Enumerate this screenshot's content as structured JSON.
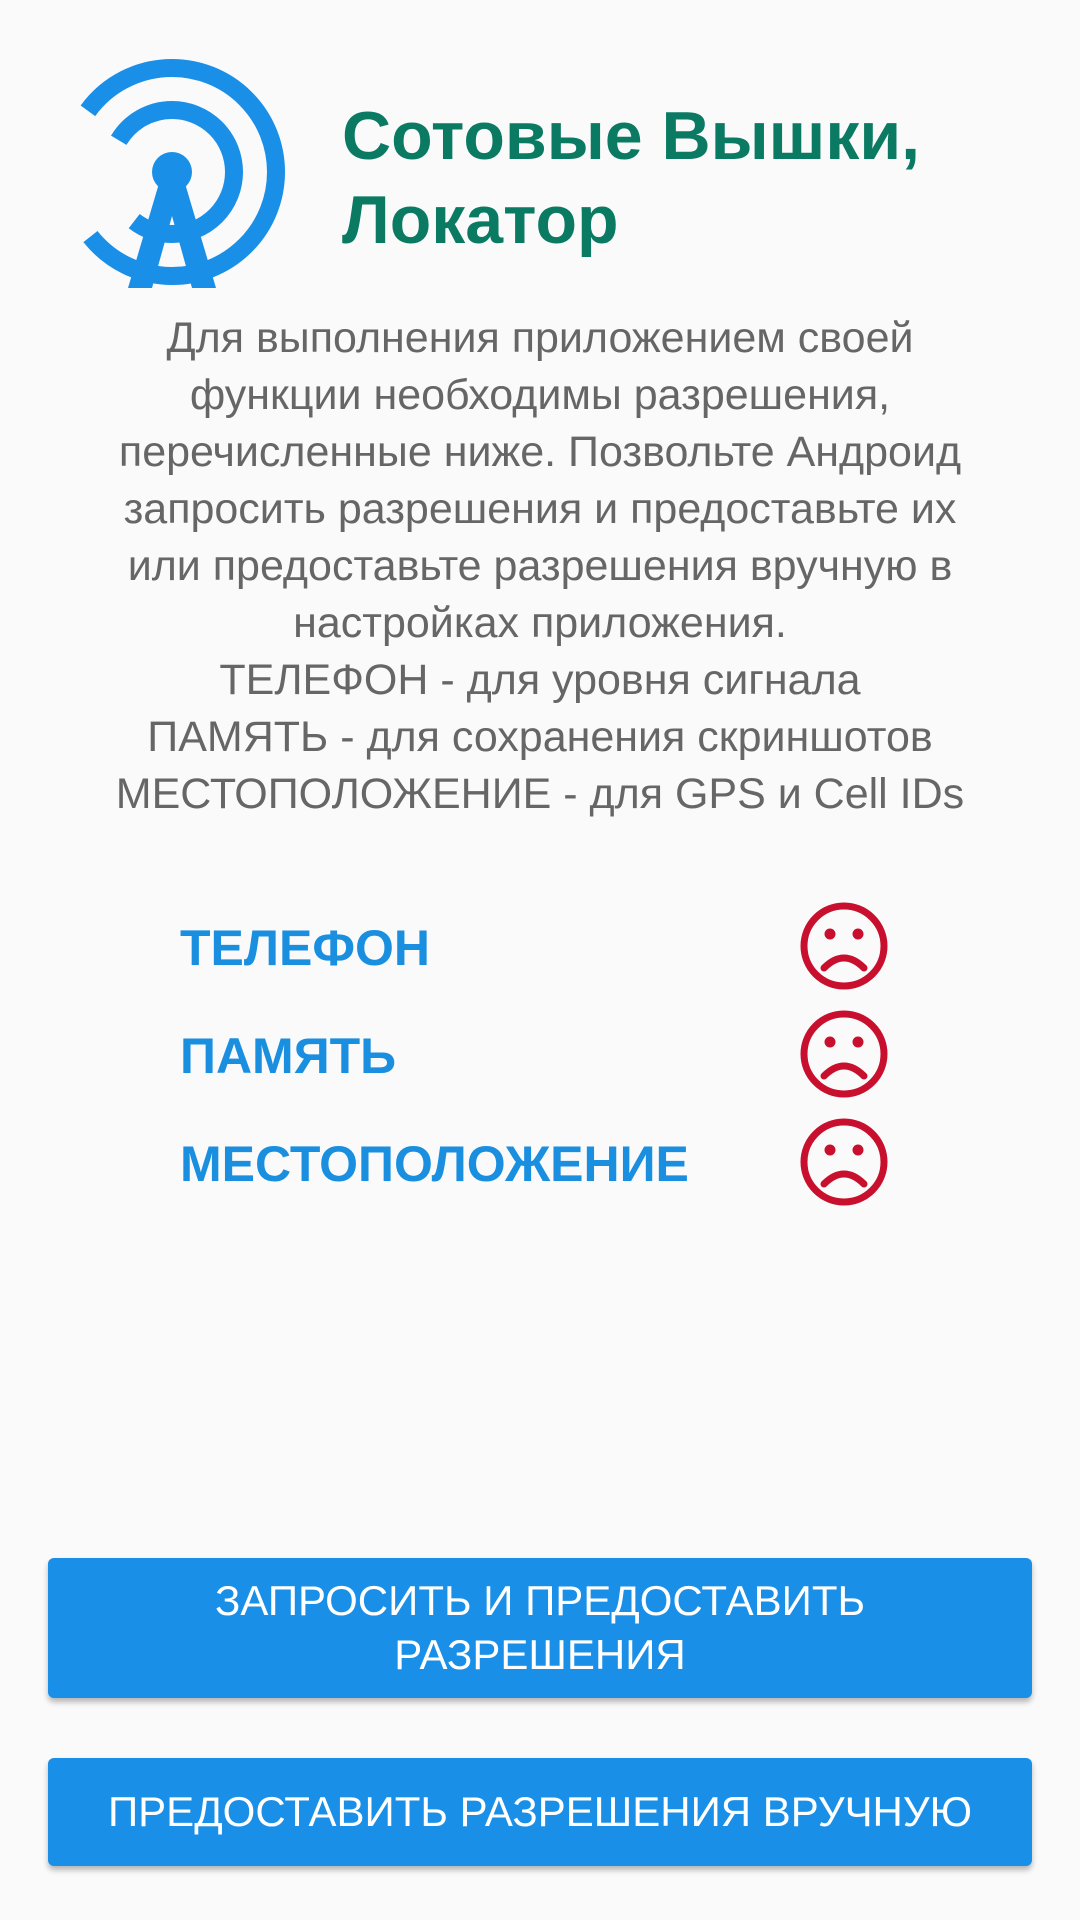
{
  "header": {
    "icon": "cell-tower-icon",
    "title": "Сотовые Вышки, Локатор"
  },
  "description": {
    "lines": [
      "Для выполнения приложением своей",
      "функции необходимы разрешения,",
      "перечисленные ниже. Позвольте Андроид",
      "запросить разрешения и предоставьте их",
      "или предоставьте разрешения вручную в",
      "настройках приложения.",
      "ТЕЛЕФОН - для уровня сигнала",
      "ПАМЯТЬ - для сохранения скриншотов",
      "МЕСТОПОЛОЖЕНИЕ - для GPS и Cell IDs"
    ]
  },
  "permissions": [
    {
      "label": "ТЕЛЕФОН",
      "status_icon": "sad-face-icon",
      "granted": false
    },
    {
      "label": "ПАМЯТЬ",
      "status_icon": "sad-face-icon",
      "granted": false
    },
    {
      "label": "МЕСТОПОЛОЖЕНИЕ",
      "status_icon": "sad-face-icon",
      "granted": false
    }
  ],
  "buttons": {
    "request_label": "ЗАПРОСИТЬ И ПРЕДОСТАВИТЬ РАЗРЕШЕНИЯ",
    "manual_label": "ПРЕДОСТАВИТЬ РАЗРЕШЕНИЯ ВРУЧНУЮ"
  },
  "colors": {
    "title": "#0b7a63",
    "accent_blue": "#1a8fe0",
    "button": "#1a8fe8",
    "denied_red": "#c8102e",
    "text_gray": "#666666",
    "background": "#fafafa"
  }
}
